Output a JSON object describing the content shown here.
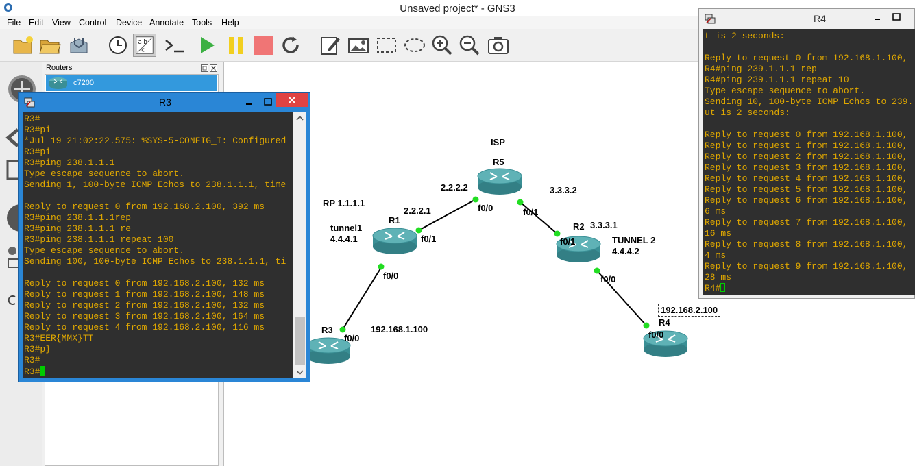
{
  "app": {
    "title": "Unsaved project* - GNS3"
  },
  "menu": [
    "File",
    "Edit",
    "View",
    "Control",
    "Device",
    "Annotate",
    "Tools",
    "Help"
  ],
  "toolbar": [
    {
      "name": "new-project-icon"
    },
    {
      "name": "open-project-icon"
    },
    {
      "name": "save-project-icon"
    },
    {
      "name": "snapshot-clock-icon"
    },
    {
      "name": "show-interface-labels-icon"
    },
    {
      "name": "console-all-icon"
    },
    {
      "name": "start-all-icon"
    },
    {
      "name": "suspend-all-icon"
    },
    {
      "name": "stop-all-icon"
    },
    {
      "name": "reload-all-icon"
    },
    {
      "name": "add-note-icon"
    },
    {
      "name": "insert-image-icon"
    },
    {
      "name": "draw-rectangle-icon"
    },
    {
      "name": "draw-ellipse-icon"
    },
    {
      "name": "zoom-in-icon"
    },
    {
      "name": "zoom-out-icon"
    },
    {
      "name": "screenshot-icon"
    }
  ],
  "routers_panel": {
    "title": "Routers",
    "items": [
      {
        "label": "c7200"
      }
    ]
  },
  "topology": {
    "nodes": [
      {
        "id": "R5",
        "label": "R5",
        "group": "ISP"
      },
      {
        "id": "R1",
        "label": "R1"
      },
      {
        "id": "R2",
        "label": "R2"
      },
      {
        "id": "R3",
        "label": "R3"
      },
      {
        "id": "R4",
        "label": "R4"
      }
    ],
    "labels": {
      "isp": "ISP",
      "r5_left_ip": "2.2.2.2",
      "r5_right_ip": "3.3.3.2",
      "rp": "RP 1.1.1.1",
      "r1_ip": "2.2.2.1",
      "tunnel1_name": "tunnel1",
      "tunnel1_ip": "4.4.4.1",
      "r2_ip": "3.3.3.1",
      "tunnel2_name": "TUNNEL 2",
      "tunnel2_ip": "4.4.4.2",
      "r3_ip": "192.168.1.100",
      "r4_ip": "192.168.2.100",
      "r5_f00": "f0/0",
      "r5_f01": "f0/1",
      "r1_f01": "f0/1",
      "r1_f00": "f0/0",
      "r2_f01": "f0/1",
      "r2_f00": "f0/0",
      "r3_f00": "f0/0",
      "r4_f00": "f0/0"
    }
  },
  "console_r3": {
    "title": "R3",
    "lines": [
      "R3#",
      "R3#pi",
      "*Jul 19 21:02:22.575: %SYS-5-CONFIG_I: Configured",
      "R3#pi",
      "R3#ping 238.1.1.1",
      "Type escape sequence to abort.",
      "Sending 1, 100-byte ICMP Echos to 238.1.1.1, time",
      "",
      "Reply to request 0 from 192.168.2.100, 392 ms",
      "R3#ping 238.1.1.1rep",
      "R3#ping 238.1.1.1 re",
      "R3#ping 238.1.1.1 repeat 100",
      "Type escape sequence to abort.",
      "Sending 100, 100-byte ICMP Echos to 238.1.1.1, ti",
      "",
      "Reply to request 0 from 192.168.2.100, 132 ms",
      "Reply to request 1 from 192.168.2.100, 148 ms",
      "Reply to request 2 from 192.168.2.100, 132 ms",
      "Reply to request 3 from 192.168.2.100, 164 ms",
      "Reply to request 4 from 192.168.2.100, 116 ms",
      "R3#EER{MMX}TT",
      "R3#p}",
      "R3#",
      "R3#"
    ]
  },
  "console_r4": {
    "title": "R4",
    "lines": [
      "t is 2 seconds:",
      "",
      "Reply to request 0 from 192.168.1.100,",
      "R4#ping 239.1.1.1 rep",
      "R4#ping 239.1.1.1 repeat 10",
      "Type escape sequence to abort.",
      "Sending 10, 100-byte ICMP Echos to 239.",
      "ut is 2 seconds:",
      "",
      "Reply to request 0 from 192.168.1.100,",
      "Reply to request 1 from 192.168.1.100,",
      "Reply to request 2 from 192.168.1.100,",
      "Reply to request 3 from 192.168.1.100,",
      "Reply to request 4 from 192.168.1.100,",
      "Reply to request 5 from 192.168.1.100,",
      "Reply to request 6 from 192.168.1.100,",
      "6 ms",
      "Reply to request 7 from 192.168.1.100,",
      "16 ms",
      "Reply to request 8 from 192.168.1.100,",
      "4 ms",
      "Reply to request 9 from 192.168.1.100,",
      "28 ms",
      "R4#"
    ]
  },
  "colors": {
    "terminal_bg": "#2f2f2f",
    "terminal_fg": "#e0a800",
    "link_dot": "#22dd22",
    "router_body": "#3a8f95",
    "r3_titlebar": "#2a86d6",
    "close_red": "#e04343"
  }
}
